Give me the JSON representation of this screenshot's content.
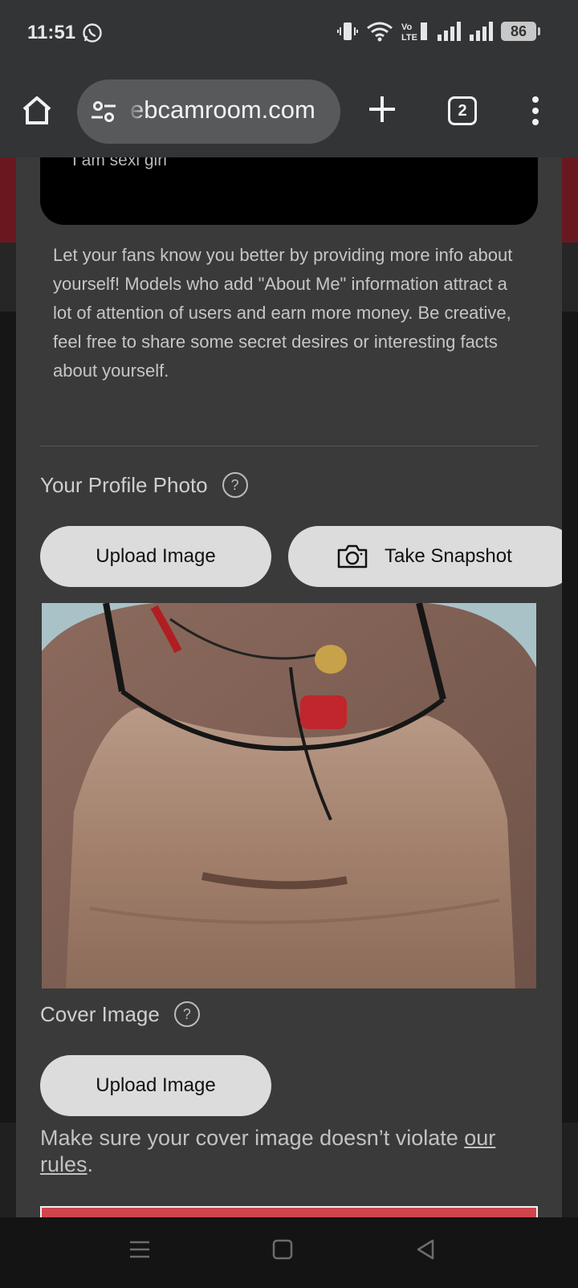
{
  "status_bar": {
    "time": "11:51",
    "battery": "86",
    "icons": [
      "whatsapp-icon",
      "vibrate-icon",
      "wifi-icon",
      "volte-icon",
      "signal-icon",
      "signal-icon",
      "battery-icon"
    ]
  },
  "browser": {
    "url": "ebcamroom.com",
    "tab_count": "2"
  },
  "about": {
    "text": "I am sexi girl",
    "hint": "Let your fans know you better by providing more info about yourself! Models who add \"About Me\" information attract a lot of attention of users and earn more money. Be creative, feel free to share some secret desires or interesting facts about yourself."
  },
  "profile_photo": {
    "title": "Your Profile Photo",
    "help": "?",
    "upload_label": "Upload Image",
    "snapshot_label": "Take Snapshot"
  },
  "cover_image": {
    "title": "Cover Image",
    "help": "?",
    "upload_label": "Upload Image",
    "note_prefix": "Make sure your cover image doesn’t violate ",
    "note_link": "our rules",
    "note_suffix": "."
  },
  "colors": {
    "panel": "#3a3a3a",
    "button": "#dcdcdc",
    "accent_red": "#d0444c"
  }
}
